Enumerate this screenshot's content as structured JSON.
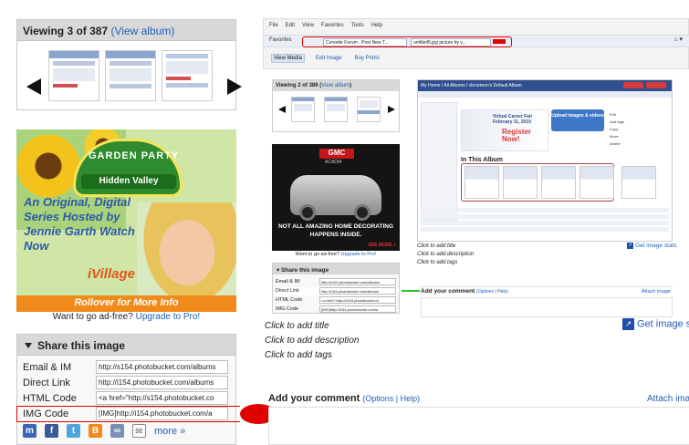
{
  "viewing": {
    "label": "Viewing 3 of 387",
    "paren_open": " (",
    "link": "View album",
    "paren_close": ")"
  },
  "ad": {
    "title": "GARDEN PARTY",
    "brand": "Hidden Valley",
    "tagline": "An Original, Digital Series Hosted by Jennie Garth Watch Now",
    "network": "iVillage",
    "cta": "Rollover for More Info"
  },
  "adfree": {
    "text": "Want to go ad-free? ",
    "link": "Upgrade to Pro!"
  },
  "share": {
    "title": "Share this image",
    "rows": [
      {
        "label": "Email & IM",
        "value": "http://s154.photobucket.com/albums"
      },
      {
        "label": "Direct Link",
        "value": "http://i154.photobucket.com/albums"
      },
      {
        "label": "HTML Code",
        "value": "<a href=\"http://s154.photobucket.co"
      },
      {
        "label": "IMG Code",
        "value": "[IMG]http://i154.photobucket.com/a"
      }
    ],
    "more": "more »"
  },
  "browser": {
    "menu": [
      "File",
      "Edit",
      "View",
      "Favorites",
      "Tools",
      "Help"
    ],
    "favorites": "Favorites",
    "tabs": [
      "Corvette Forum - Post New T...",
      "untitled5.jpg picture by v..."
    ],
    "nav_tabs": [
      "View Media",
      "Edit Image",
      "Buy Prints"
    ]
  },
  "nested": {
    "viewing_label": "Viewing 2 of 386",
    "viewing_link": "View album",
    "gmc_brand": "GMC",
    "gmc_model": "ACADIA",
    "gmc_text": "NOT ALL AMAZING HOME DECORATING HAPPENS INSIDE.",
    "gmc_see": "SEE MORE »",
    "adfree_text": "Want to go ad-free? ",
    "adfree_link": "Upgrade to Pro!",
    "share_title": "Share this image",
    "share_rows": [
      {
        "label": "Email & IM",
        "value": "http://s154.photobucket.com/albums"
      },
      {
        "label": "Direct Link",
        "value": "http://i154.photobucket.com/albums"
      },
      {
        "label": "HTML Code",
        "value": "<a href=\"http://s154.photobucket.co"
      },
      {
        "label": "IMG Code",
        "value": "[IMG]http://i154.photobucket.com/a"
      }
    ],
    "inner_header": "My Home / All Albums / vbcorteon's Default Album",
    "inner_promo": "Virtual Career Fair February 11, 2010",
    "inner_register": "Register Now!",
    "inner_upload": "Upload images & videos",
    "inner_album_title": "In This Album",
    "inner_options": [
      "Edit",
      "Add tags",
      "Copy",
      "Move",
      "Delete"
    ],
    "add_title": "Click to add title",
    "add_description": "Click to add description",
    "add_tags": "Click to add tags",
    "stats": "Get image stats",
    "comment_title": "Add your comment",
    "comment_options": "(Options | Help)",
    "attach": "Attach image"
  },
  "main": {
    "add_title": "Click to add title",
    "add_description": "Click to add description",
    "add_tags": "Click to add tags",
    "stats": "Get image st",
    "comment_title": "Add your comment",
    "comment_options": "(Options | Help)",
    "attach": "Attach ima"
  },
  "colors": {
    "annotation_red": "#e00000",
    "link_blue": "#1f5fb4",
    "highlight_green": "#28c428"
  }
}
